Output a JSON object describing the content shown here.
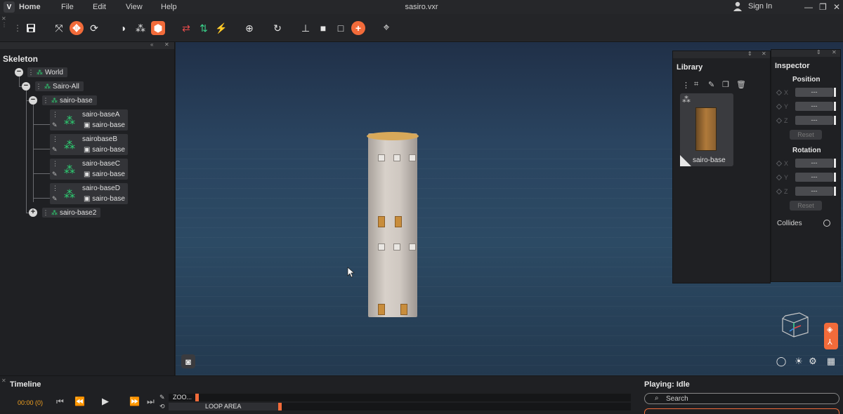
{
  "app": {
    "home_label": "Home",
    "window_title": "sasiro.vxr",
    "signin_label": "Sign In"
  },
  "menu": [
    "File",
    "Edit",
    "View",
    "Help"
  ],
  "window_controls": {
    "minimize": "—",
    "restore": "❐",
    "close": "✕"
  },
  "skeleton": {
    "title": "Skeleton",
    "world": "World",
    "sairo_all": "Sairo-All",
    "sairo_base": "sairo-base",
    "cards": [
      {
        "name": "sairo-baseA",
        "sub": "sairo-base"
      },
      {
        "name": "sairobaseB",
        "sub": "sairo-base"
      },
      {
        "name": "sairo-baseC",
        "sub": "sairo-base"
      },
      {
        "name": "sairo-baseD",
        "sub": "sairo-base"
      }
    ],
    "sairo_base2": "sairo-base2"
  },
  "library": {
    "title": "Library",
    "item_label": "sairo-base"
  },
  "inspector": {
    "title": "Inspector",
    "position_label": "Position",
    "rotation_label": "Rotation",
    "axes": [
      "X",
      "Y",
      "Z"
    ],
    "field_value": "---",
    "reset_label": "Reset",
    "collides_label": "Collides"
  },
  "timeline": {
    "title": "Timeline",
    "time": "00:00 (0)",
    "zoom_label": "ZOO...",
    "loop_label": "LOOP AREA"
  },
  "playing": {
    "status": "Playing: Idle",
    "search_placeholder": "Search"
  },
  "colors": {
    "accent": "#f26b3a",
    "node_icon": "#2ecc71",
    "time_text": "#f0a020"
  }
}
